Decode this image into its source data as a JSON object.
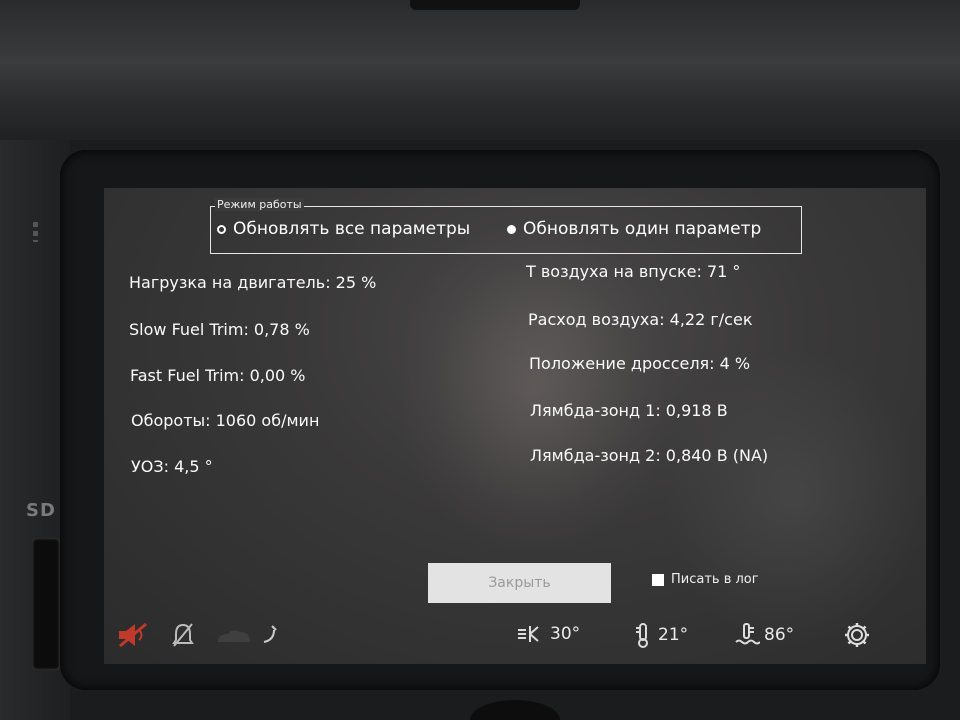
{
  "mode": {
    "legend": "Режим работы",
    "options": [
      {
        "label": "Обновлять все параметры",
        "selected": false
      },
      {
        "label": "Обновлять один параметр",
        "selected": true
      }
    ]
  },
  "params_left": [
    {
      "label": "Нагрузка на двигатель: 25 %"
    },
    {
      "label": "Slow Fuel Trim: 0,78 %"
    },
    {
      "label": "Fast Fuel Trim: 0,00 %"
    },
    {
      "label": "Обороты: 1060 об/мин"
    },
    {
      "label": "УОЗ: 4,5 °"
    }
  ],
  "params_right": [
    {
      "label": "Т воздуха на впуске: 71 °"
    },
    {
      "label": "Расход воздуха: 4,22 г/сек"
    },
    {
      "label": "Положение дросселя: 4 %"
    },
    {
      "label": "Лямбда-зонд 1: 0,918 В"
    },
    {
      "label": "Лямбда-зонд 2: 0,840 В (NA)"
    }
  ],
  "controls": {
    "close_label": "Закрыть",
    "log_label": "Писать в лог",
    "log_checked": false
  },
  "status": {
    "fan_temp": "30°",
    "cabin_temp": "21°",
    "engine_temp": "86°",
    "icons": [
      "mute-icon",
      "bell-off-icon",
      "cloud-icon",
      "horn-icon",
      "fan-icon",
      "thermometer-icon",
      "coolant-icon",
      "gear-icon"
    ],
    "mute_color": "#c0392b"
  },
  "bezel": {
    "sd_label": "SD"
  }
}
